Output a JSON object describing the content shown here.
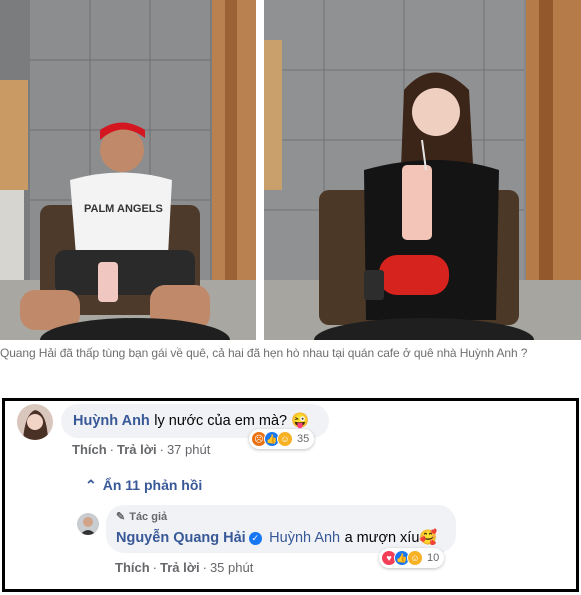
{
  "caption": "Quang Hải đã thấp tùng bạn gái về quê, cả hai đã hẹn hò nhau tại quán cafe ở quê nhà Huỳnh Anh ?",
  "comment1": {
    "author": "Huỳnh Anh",
    "message": "ly nước của em mà? 😜",
    "like_label": "Thích",
    "reply_label": "Trả lời",
    "time": "37 phút",
    "reaction_count": "35",
    "reaction_icons": [
      "angry-icon",
      "like-icon",
      "haha-icon"
    ]
  },
  "replies_toggle": "Ẩn 11 phản hồi",
  "comment2": {
    "role": "Tác giả",
    "author": "Nguyễn Quang Hải",
    "mention": "Huỳnh Anh",
    "message": "a mượn xíu🥰",
    "like_label": "Thích",
    "reply_label": "Trả lời",
    "time": "35 phút",
    "reaction_count": "10",
    "reaction_icons": [
      "love-icon",
      "like-icon",
      "haha-icon"
    ]
  },
  "colors": {
    "link_blue": "#385898",
    "bubble": "#f0f2f5",
    "muted": "#65676b"
  }
}
